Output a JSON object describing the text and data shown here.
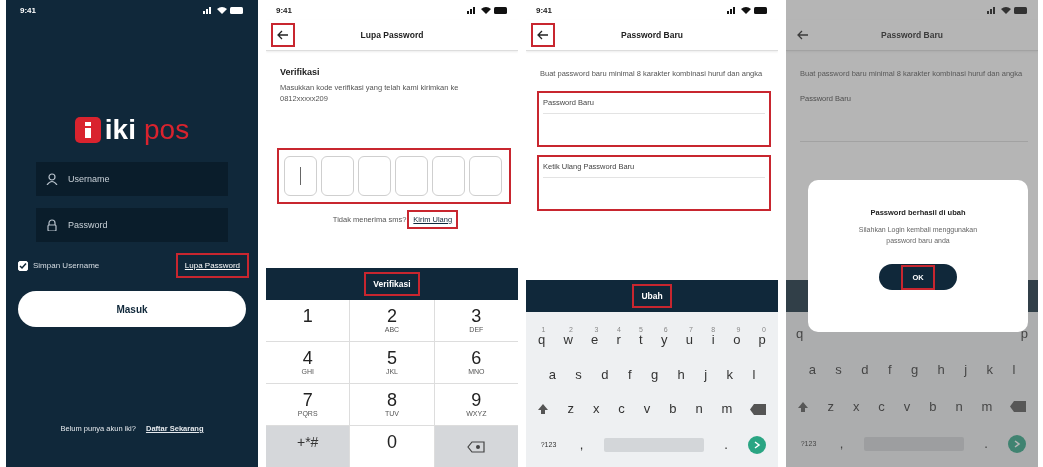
{
  "login_screen": {
    "time": "9:41",
    "logo_text": "iki",
    "logo_accent": "pos",
    "fields": [
      {
        "kind": "user",
        "placeholder": "Username"
      },
      {
        "kind": "lock",
        "placeholder": "Password"
      }
    ],
    "remember": {
      "label": "Simpan Username",
      "checked": true
    },
    "forgot_link": {
      "label": "Lupa Password",
      "highlighted": true
    },
    "login_button": "Masuk",
    "signup_prompt": "Belum punya akun iki?",
    "signup_link": "Daftar Sekarang"
  },
  "otp_screen": {
    "time": "9:41",
    "title": "Lupa Password",
    "back_highlighted": true,
    "heading": "Verifikasi",
    "description": "Masukkan kode verifikasi yang telah kami kirimkan ke 0812xxxxx209",
    "otp": {
      "highlighted": true,
      "boxes": [
        {
          "focused": true
        },
        {
          "focused": false
        },
        {
          "focused": false
        },
        {
          "focused": false
        },
        {
          "focused": false
        },
        {
          "focused": false
        }
      ]
    },
    "resend_prompt": "Tidak menerima sms?",
    "resend_link": {
      "label": "Kirim Ulang",
      "highlighted": true
    },
    "submit": {
      "label": "Verifikasi",
      "highlighted": true
    },
    "keypad": [
      {
        "kind": "digit",
        "digit": "1"
      },
      {
        "kind": "digit",
        "digit": "2",
        "letters": "ABC"
      },
      {
        "kind": "digit",
        "digit": "3",
        "letters": "DEF"
      },
      {
        "kind": "digit",
        "digit": "4",
        "letters": "GHI"
      },
      {
        "kind": "digit",
        "digit": "5",
        "letters": "JKL"
      },
      {
        "kind": "digit",
        "digit": "6",
        "letters": "MNO"
      },
      {
        "kind": "digit",
        "digit": "7",
        "letters": "PQRS"
      },
      {
        "kind": "digit",
        "digit": "8",
        "letters": "TUV"
      },
      {
        "kind": "digit",
        "digit": "9",
        "letters": "WXYZ"
      },
      {
        "kind": "symbol",
        "digit": "+*#"
      },
      {
        "kind": "digit",
        "digit": "0"
      },
      {
        "kind": "backspace"
      }
    ]
  },
  "new_password_screen": {
    "time": "9:41",
    "title": "Password Baru",
    "back_highlighted": true,
    "description": "Buat password baru minimal 8 karakter kombinasi huruf dan angka",
    "fields": [
      {
        "label": "Password Baru",
        "highlighted": true
      },
      {
        "label": "Ketik Ulang Password Baru",
        "highlighted": true
      }
    ],
    "submit": {
      "label": "Ubah",
      "highlighted": true
    },
    "keyboard": [
      {
        "keys": [
          {
            "kind": "letter",
            "key": "q",
            "hint": "1"
          },
          {
            "kind": "letter",
            "key": "w",
            "hint": "2"
          },
          {
            "kind": "letter",
            "key": "e",
            "hint": "3"
          },
          {
            "kind": "letter",
            "key": "r",
            "hint": "4"
          },
          {
            "kind": "letter",
            "key": "t",
            "hint": "5"
          },
          {
            "kind": "letter",
            "key": "y",
            "hint": "6"
          },
          {
            "kind": "letter",
            "key": "u",
            "hint": "7"
          },
          {
            "kind": "letter",
            "key": "i",
            "hint": "8"
          },
          {
            "kind": "letter",
            "key": "o",
            "hint": "9"
          },
          {
            "kind": "letter",
            "key": "p",
            "hint": "0"
          }
        ]
      },
      {
        "keys": [
          {
            "kind": "letter",
            "key": "a"
          },
          {
            "kind": "letter",
            "key": "s"
          },
          {
            "kind": "letter",
            "key": "d"
          },
          {
            "kind": "letter",
            "key": "f"
          },
          {
            "kind": "letter",
            "key": "g"
          },
          {
            "kind": "letter",
            "key": "h"
          },
          {
            "kind": "letter",
            "key": "j"
          },
          {
            "kind": "letter",
            "key": "k"
          },
          {
            "kind": "letter",
            "key": "l"
          }
        ]
      },
      {
        "keys": [
          {
            "kind": "shift"
          },
          {
            "kind": "letter",
            "key": "z"
          },
          {
            "kind": "letter",
            "key": "x"
          },
          {
            "kind": "letter",
            "key": "c"
          },
          {
            "kind": "letter",
            "key": "v"
          },
          {
            "kind": "letter",
            "key": "b"
          },
          {
            "kind": "letter",
            "key": "n"
          },
          {
            "kind": "letter",
            "key": "m"
          },
          {
            "kind": "backspace"
          }
        ]
      },
      {
        "keys": [
          {
            "kind": "mode",
            "key": "?123"
          },
          {
            "kind": "letter",
            "key": ","
          },
          {
            "kind": "space"
          },
          {
            "kind": "letter",
            "key": "."
          },
          {
            "kind": "go"
          }
        ]
      }
    ]
  },
  "success_screen": {
    "title": "Password Baru",
    "description": "Buat password baru minimal 8 karakter kombinasi huruf dan angka",
    "field_label": "Password Baru",
    "dialog": {
      "title": "Password berhasil di ubah",
      "message": "Silahkan Login kembali menggunakan password baru anda",
      "button": {
        "label": "OK",
        "highlighted": true
      }
    },
    "keyboard": [
      {
        "keys": [
          {
            "kind": "letter",
            "key": "q"
          },
          {
            "kind": "letter",
            "key": "p"
          }
        ]
      },
      {
        "keys": [
          {
            "kind": "letter",
            "key": "a"
          },
          {
            "kind": "letter",
            "key": "s"
          },
          {
            "kind": "letter",
            "key": "d"
          },
          {
            "kind": "letter",
            "key": "f"
          },
          {
            "kind": "letter",
            "key": "g"
          },
          {
            "kind": "letter",
            "key": "h"
          },
          {
            "kind": "letter",
            "key": "j"
          },
          {
            "kind": "letter",
            "key": "k"
          },
          {
            "kind": "letter",
            "key": "l"
          }
        ]
      },
      {
        "keys": [
          {
            "kind": "shift"
          },
          {
            "kind": "letter",
            "key": "z"
          },
          {
            "kind": "letter",
            "key": "x"
          },
          {
            "kind": "letter",
            "key": "c"
          },
          {
            "kind": "letter",
            "key": "v"
          },
          {
            "kind": "letter",
            "key": "b"
          },
          {
            "kind": "letter",
            "key": "n"
          },
          {
            "kind": "letter",
            "key": "m"
          },
          {
            "kind": "backspace"
          }
        ]
      },
      {
        "keys": [
          {
            "kind": "mode",
            "key": "?123"
          },
          {
            "kind": "letter",
            "key": ","
          },
          {
            "kind": "space"
          },
          {
            "kind": "letter",
            "key": "."
          },
          {
            "kind": "go"
          }
        ]
      }
    ]
  }
}
